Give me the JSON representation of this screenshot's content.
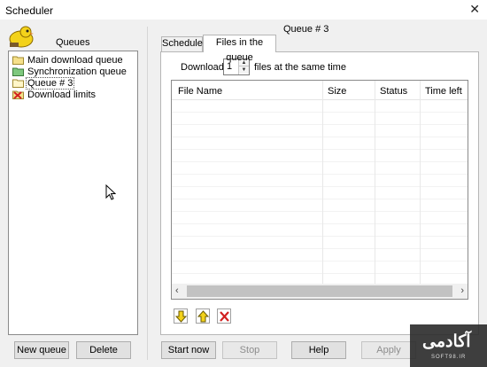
{
  "window": {
    "title": "Scheduler",
    "close_glyph": "✕"
  },
  "sidebar": {
    "heading": "Queues",
    "items": [
      {
        "label": "Main download queue",
        "icon": "folder-icon"
      },
      {
        "label": "Synchronization queue",
        "icon": "sync-folder-icon"
      },
      {
        "label": "Queue # 3",
        "icon": "folder-icon",
        "selected": true
      },
      {
        "label": "Download limits",
        "icon": "download-limits-icon"
      }
    ],
    "new_queue_button": "New queue",
    "delete_button": "Delete"
  },
  "main": {
    "queue_title": "Queue # 3",
    "tabs": [
      {
        "label": "Schedule",
        "active": false
      },
      {
        "label": "Files in the queue",
        "active": true
      }
    ],
    "download_label": "Download",
    "concurrent_files": "1",
    "download_suffix": "files at the same time",
    "table": {
      "columns": [
        "File Name",
        "Size",
        "Status",
        "Time left"
      ],
      "rows": []
    }
  },
  "footer": {
    "start_now": "Start now",
    "stop": "Stop",
    "help": "Help",
    "apply": "Apply"
  },
  "watermark": {
    "text": "آکادمی",
    "sub": "SOFT98.IR"
  },
  "colors": {
    "folder": "#f5e08a",
    "sync_folder": "#7ec87e",
    "delete_red": "#d21f1f",
    "arrow_yellow": "#f3d21a"
  }
}
